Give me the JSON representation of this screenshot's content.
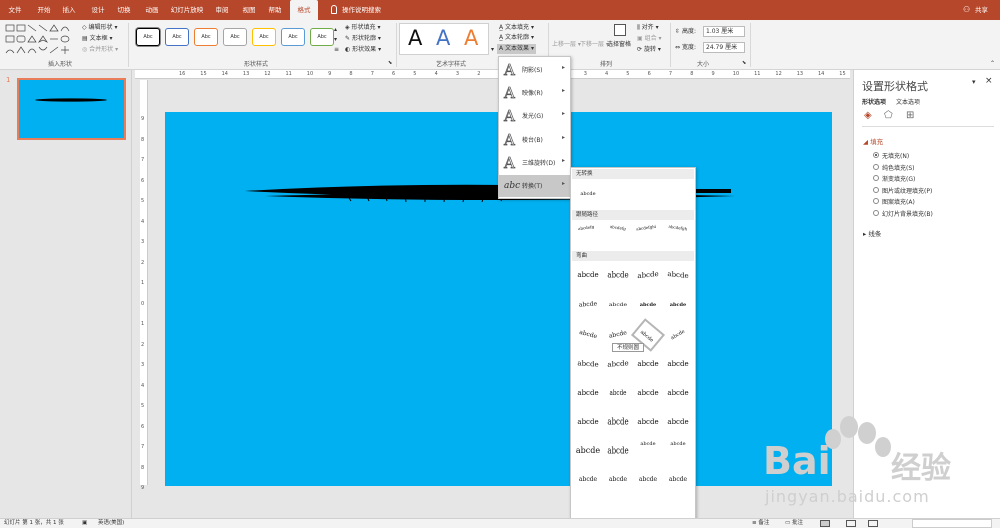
{
  "tabs": [
    "文件",
    "开始",
    "插入",
    "设计",
    "切换",
    "动画",
    "幻灯片放映",
    "审阅",
    "视图",
    "帮助",
    "格式"
  ],
  "active_tab": "格式",
  "tell_me": "操作说明搜索",
  "share": "共享",
  "ribbon": {
    "insert_shapes": {
      "label": "插入形状",
      "edit_shape": "编辑形状",
      "text_box": "文本框",
      "merge_shapes": "合并形状"
    },
    "shape_styles": {
      "label": "形状样式",
      "preset": "Abc",
      "fill": "形状填充",
      "outline": "形状轮廓",
      "effects": "形状效果"
    },
    "wordart": {
      "label": "艺术字样式",
      "A": "A",
      "text_fill": "文本填充",
      "text_outline": "文本轮廓",
      "text_effects": "文本效果"
    },
    "arrange": {
      "label": "排列",
      "bring_forward": "上移一层",
      "send_backward": "下移一层",
      "selection_pane": "选择窗格",
      "align": "对齐",
      "group": "组合",
      "rotate": "旋转"
    },
    "size": {
      "label": "大小",
      "height_label": "高度:",
      "height": "1.03 厘米",
      "width_label": "宽度:",
      "width": "24.79 厘米"
    }
  },
  "ruler": {
    "h": [
      "16",
      "15",
      "14",
      "13",
      "12",
      "11",
      "10",
      "9",
      "8",
      "7",
      "6",
      "5",
      "4",
      "3",
      "2",
      "1",
      "0",
      "1",
      "2",
      "3",
      "4",
      "5",
      "6",
      "7",
      "8",
      "9",
      "10",
      "11",
      "12",
      "13",
      "14",
      "15",
      "16"
    ],
    "v": [
      "9",
      "8",
      "7",
      "6",
      "5",
      "4",
      "3",
      "2",
      "1",
      "0",
      "1",
      "2",
      "3",
      "4",
      "5",
      "6",
      "7",
      "8",
      "9"
    ]
  },
  "slide_number": "1",
  "text_effects_menu": [
    {
      "label": "阴影(S)",
      "arrow": "▸"
    },
    {
      "label": "映像(R)",
      "arrow": "▸"
    },
    {
      "label": "发光(G)",
      "arrow": "▸"
    },
    {
      "label": "棱台(B)",
      "arrow": "▸"
    },
    {
      "label": "三维旋转(D)",
      "arrow": "▸"
    },
    {
      "label": "转换(T)",
      "arrow": "▸"
    }
  ],
  "menu_icon_letter": "A",
  "transform_icon_text": "abc",
  "transform_gallery": {
    "no_transform": "无转换",
    "plain_text": "abcde",
    "follow_path": "跟随路径",
    "path_samples": [
      "abcdefg",
      "abcdefg",
      "abcdefghi",
      "abcdefgh"
    ],
    "warp": "弯曲",
    "warp_sample": "abcde",
    "hover_tooltip": "不规则圆"
  },
  "format_pane": {
    "title": "设置形状格式",
    "tabs": [
      "形状选项",
      "文本选项"
    ],
    "fill_section": "填充",
    "fill_options": [
      "无填充(N)",
      "纯色填充(S)",
      "渐变填充(G)",
      "图片或纹理填充(P)",
      "图案填充(A)",
      "幻灯片背景填充(B)"
    ],
    "fill_selected": 0,
    "line_section": "线条"
  },
  "status_bar": {
    "slide_info": "幻灯片 第 1 张，共 1 张",
    "language": "英语(美国)",
    "notes": "备注",
    "comments": "批注"
  },
  "watermark": {
    "brand": "Bai",
    "brand2": "经验",
    "url": "jingyan.baidu.com"
  },
  "colors": {
    "accent": "#b7472a",
    "slide_bg": "#00b0f0"
  }
}
